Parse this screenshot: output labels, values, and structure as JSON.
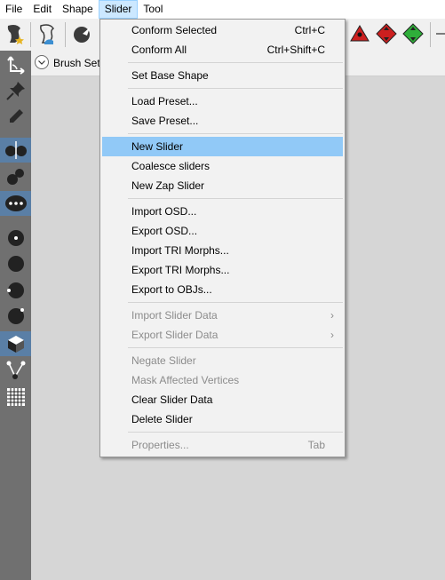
{
  "menubar": {
    "items": [
      {
        "label": "File"
      },
      {
        "label": "Edit"
      },
      {
        "label": "Shape"
      },
      {
        "label": "Slider"
      },
      {
        "label": "Tool"
      }
    ]
  },
  "toolbar": {
    "icons": [
      "new-project-icon",
      "load-reference-icon",
      "brush-icon",
      "conform-red-icon",
      "conform-red-arrows-icon",
      "conform-green-arrows-icon"
    ]
  },
  "brush_bar": {
    "label": "Brush Sett"
  },
  "dropdown": {
    "items": [
      {
        "label": "Conform Selected",
        "shortcut": "Ctrl+C"
      },
      {
        "label": "Conform All",
        "shortcut": "Ctrl+Shift+C"
      },
      {
        "label": "Set Base Shape",
        "shortcut": ""
      },
      {
        "label": "Load Preset...",
        "shortcut": ""
      },
      {
        "label": "Save Preset...",
        "shortcut": ""
      },
      {
        "label": "New Slider",
        "shortcut": ""
      },
      {
        "label": "Coalesce sliders",
        "shortcut": ""
      },
      {
        "label": "New Zap Slider",
        "shortcut": ""
      },
      {
        "label": "Import OSD...",
        "shortcut": ""
      },
      {
        "label": "Export OSD...",
        "shortcut": ""
      },
      {
        "label": "Import TRI Morphs...",
        "shortcut": ""
      },
      {
        "label": "Export TRI Morphs...",
        "shortcut": ""
      },
      {
        "label": "Export to OBJs...",
        "shortcut": ""
      },
      {
        "label": "Import Slider Data",
        "shortcut": ""
      },
      {
        "label": "Export Slider Data",
        "shortcut": ""
      },
      {
        "label": "Negate Slider",
        "shortcut": ""
      },
      {
        "label": "Mask Affected Vertices",
        "shortcut": ""
      },
      {
        "label": "Clear Slider Data",
        "shortcut": ""
      },
      {
        "label": "Delete Slider",
        "shortcut": ""
      },
      {
        "label": "Properties...",
        "shortcut": "Tab"
      }
    ]
  },
  "colors": {
    "menu_highlight": "#91c9f7",
    "menubar_active": "#cce8ff",
    "tool_selected": "#5a7fa6",
    "left_panel": "#707070",
    "disabled_text": "#8c8c8c"
  }
}
